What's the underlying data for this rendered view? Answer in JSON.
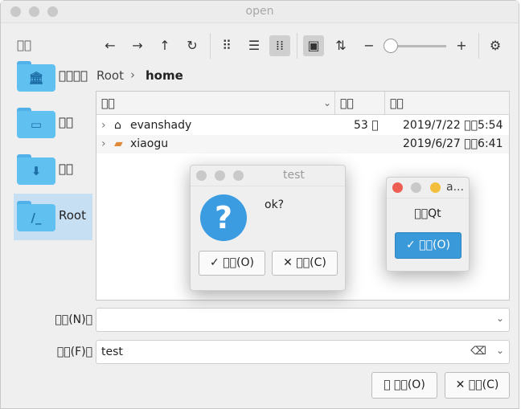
{
  "window": {
    "title": "open"
  },
  "sidebar": {
    "header": "􀀀􀀀",
    "items": [
      {
        "label": "􀀀􀀀􀀀􀀀",
        "icon": "bank-icon",
        "glyph": "🏛"
      },
      {
        "label": "􀀀􀀀",
        "icon": "monitor-icon",
        "glyph": "▭"
      },
      {
        "label": "􀀀􀀀",
        "icon": "download-icon",
        "glyph": "⬇"
      },
      {
        "label": "Root",
        "icon": "root-folder-icon",
        "glyph": "/_"
      }
    ]
  },
  "toolbar": {
    "back": "←",
    "forward": "→",
    "up": "↑",
    "reload": "↻",
    "icon_view": "⠿",
    "list_view": "☰",
    "compact_view": "⁞⁞",
    "preview": "▣",
    "sort": "⇅",
    "zoom_out": "−",
    "zoom_in": "+",
    "settings": "⚙"
  },
  "breadcrumb": {
    "root": "Root",
    "separator": "›",
    "current": "home"
  },
  "file_list": {
    "columns": [
      "􀀀􀀀",
      "􀀀􀀀",
      "􀀀􀀀"
    ],
    "rows": [
      {
        "name": "evanshady",
        "size": "53 􀀀",
        "date": "2019/7/22 􀀀􀀀5:54",
        "expander": "›",
        "icon": "⌂"
      },
      {
        "name": "xiaogu",
        "size": "",
        "date": "2019/6/27 􀀀􀀀6:41",
        "expander": "›",
        "icon": "▰"
      }
    ]
  },
  "form": {
    "name_label": "􀀀􀀀(N)􀀀",
    "name_value": "",
    "filter_label": "􀀀􀀀(F)􀀀",
    "filter_value": "test"
  },
  "buttons": {
    "open": "􀀀􀀀(O)",
    "cancel": "􀀀􀀀(C)",
    "open_icon": "⤒",
    "cancel_icon": "✕"
  },
  "dialog_test": {
    "title": "test",
    "message": "ok?",
    "icon": "?",
    "ok_label": "✓ 􀀀􀀀(O)",
    "cancel_label": "✕ 􀀀􀀀(C)"
  },
  "dialog_about": {
    "title": "a...",
    "message": "􀀀􀀀Qt",
    "ok_label": "✓ 􀀀􀀀(O)"
  },
  "colors": {
    "accent": "#3a99d8",
    "folder": "#60c0f0",
    "close": "#ed5e53",
    "minimize": "#f3be3b"
  }
}
